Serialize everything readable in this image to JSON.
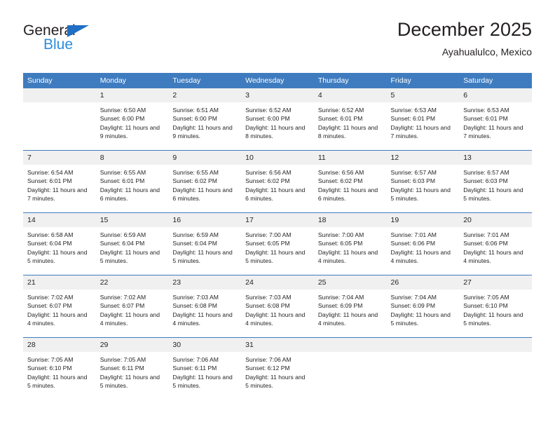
{
  "brand": {
    "name_top": "General",
    "name_bottom": "Blue",
    "triangle_color": "#1f6fc4",
    "blue_text_color": "#2b8ddf"
  },
  "header": {
    "title": "December 2025",
    "subtitle": "Ayahualulco, Mexico",
    "header_bg_color": "#3f7cbf",
    "daynum_bg_color": "#f0f0f0"
  },
  "calendar": {
    "weekday_headers": [
      "Sunday",
      "Monday",
      "Tuesday",
      "Wednesday",
      "Thursday",
      "Friday",
      "Saturday"
    ],
    "labels": {
      "sunrise": "Sunrise:",
      "sunset": "Sunset:",
      "daylight": "Daylight:"
    },
    "weeks": [
      [
        {
          "day": "",
          "empty": true
        },
        {
          "day": "1",
          "sunrise": "Sunrise: 6:50 AM",
          "sunset": "Sunset: 6:00 PM",
          "daylight": "Daylight: 11 hours and 9 minutes."
        },
        {
          "day": "2",
          "sunrise": "Sunrise: 6:51 AM",
          "sunset": "Sunset: 6:00 PM",
          "daylight": "Daylight: 11 hours and 9 minutes."
        },
        {
          "day": "3",
          "sunrise": "Sunrise: 6:52 AM",
          "sunset": "Sunset: 6:00 PM",
          "daylight": "Daylight: 11 hours and 8 minutes."
        },
        {
          "day": "4",
          "sunrise": "Sunrise: 6:52 AM",
          "sunset": "Sunset: 6:01 PM",
          "daylight": "Daylight: 11 hours and 8 minutes."
        },
        {
          "day": "5",
          "sunrise": "Sunrise: 6:53 AM",
          "sunset": "Sunset: 6:01 PM",
          "daylight": "Daylight: 11 hours and 7 minutes."
        },
        {
          "day": "6",
          "sunrise": "Sunrise: 6:53 AM",
          "sunset": "Sunset: 6:01 PM",
          "daylight": "Daylight: 11 hours and 7 minutes."
        }
      ],
      [
        {
          "day": "7",
          "sunrise": "Sunrise: 6:54 AM",
          "sunset": "Sunset: 6:01 PM",
          "daylight": "Daylight: 11 hours and 7 minutes."
        },
        {
          "day": "8",
          "sunrise": "Sunrise: 6:55 AM",
          "sunset": "Sunset: 6:01 PM",
          "daylight": "Daylight: 11 hours and 6 minutes."
        },
        {
          "day": "9",
          "sunrise": "Sunrise: 6:55 AM",
          "sunset": "Sunset: 6:02 PM",
          "daylight": "Daylight: 11 hours and 6 minutes."
        },
        {
          "day": "10",
          "sunrise": "Sunrise: 6:56 AM",
          "sunset": "Sunset: 6:02 PM",
          "daylight": "Daylight: 11 hours and 6 minutes."
        },
        {
          "day": "11",
          "sunrise": "Sunrise: 6:56 AM",
          "sunset": "Sunset: 6:02 PM",
          "daylight": "Daylight: 11 hours and 6 minutes."
        },
        {
          "day": "12",
          "sunrise": "Sunrise: 6:57 AM",
          "sunset": "Sunset: 6:03 PM",
          "daylight": "Daylight: 11 hours and 5 minutes."
        },
        {
          "day": "13",
          "sunrise": "Sunrise: 6:57 AM",
          "sunset": "Sunset: 6:03 PM",
          "daylight": "Daylight: 11 hours and 5 minutes."
        }
      ],
      [
        {
          "day": "14",
          "sunrise": "Sunrise: 6:58 AM",
          "sunset": "Sunset: 6:04 PM",
          "daylight": "Daylight: 11 hours and 5 minutes."
        },
        {
          "day": "15",
          "sunrise": "Sunrise: 6:59 AM",
          "sunset": "Sunset: 6:04 PM",
          "daylight": "Daylight: 11 hours and 5 minutes."
        },
        {
          "day": "16",
          "sunrise": "Sunrise: 6:59 AM",
          "sunset": "Sunset: 6:04 PM",
          "daylight": "Daylight: 11 hours and 5 minutes."
        },
        {
          "day": "17",
          "sunrise": "Sunrise: 7:00 AM",
          "sunset": "Sunset: 6:05 PM",
          "daylight": "Daylight: 11 hours and 5 minutes."
        },
        {
          "day": "18",
          "sunrise": "Sunrise: 7:00 AM",
          "sunset": "Sunset: 6:05 PM",
          "daylight": "Daylight: 11 hours and 4 minutes."
        },
        {
          "day": "19",
          "sunrise": "Sunrise: 7:01 AM",
          "sunset": "Sunset: 6:06 PM",
          "daylight": "Daylight: 11 hours and 4 minutes."
        },
        {
          "day": "20",
          "sunrise": "Sunrise: 7:01 AM",
          "sunset": "Sunset: 6:06 PM",
          "daylight": "Daylight: 11 hours and 4 minutes."
        }
      ],
      [
        {
          "day": "21",
          "sunrise": "Sunrise: 7:02 AM",
          "sunset": "Sunset: 6:07 PM",
          "daylight": "Daylight: 11 hours and 4 minutes."
        },
        {
          "day": "22",
          "sunrise": "Sunrise: 7:02 AM",
          "sunset": "Sunset: 6:07 PM",
          "daylight": "Daylight: 11 hours and 4 minutes."
        },
        {
          "day": "23",
          "sunrise": "Sunrise: 7:03 AM",
          "sunset": "Sunset: 6:08 PM",
          "daylight": "Daylight: 11 hours and 4 minutes."
        },
        {
          "day": "24",
          "sunrise": "Sunrise: 7:03 AM",
          "sunset": "Sunset: 6:08 PM",
          "daylight": "Daylight: 11 hours and 4 minutes."
        },
        {
          "day": "25",
          "sunrise": "Sunrise: 7:04 AM",
          "sunset": "Sunset: 6:09 PM",
          "daylight": "Daylight: 11 hours and 4 minutes."
        },
        {
          "day": "26",
          "sunrise": "Sunrise: 7:04 AM",
          "sunset": "Sunset: 6:09 PM",
          "daylight": "Daylight: 11 hours and 5 minutes."
        },
        {
          "day": "27",
          "sunrise": "Sunrise: 7:05 AM",
          "sunset": "Sunset: 6:10 PM",
          "daylight": "Daylight: 11 hours and 5 minutes."
        }
      ],
      [
        {
          "day": "28",
          "sunrise": "Sunrise: 7:05 AM",
          "sunset": "Sunset: 6:10 PM",
          "daylight": "Daylight: 11 hours and 5 minutes."
        },
        {
          "day": "29",
          "sunrise": "Sunrise: 7:05 AM",
          "sunset": "Sunset: 6:11 PM",
          "daylight": "Daylight: 11 hours and 5 minutes."
        },
        {
          "day": "30",
          "sunrise": "Sunrise: 7:06 AM",
          "sunset": "Sunset: 6:11 PM",
          "daylight": "Daylight: 11 hours and 5 minutes."
        },
        {
          "day": "31",
          "sunrise": "Sunrise: 7:06 AM",
          "sunset": "Sunset: 6:12 PM",
          "daylight": "Daylight: 11 hours and 5 minutes."
        },
        {
          "day": "",
          "empty": true
        },
        {
          "day": "",
          "empty": true
        },
        {
          "day": "",
          "empty": true
        }
      ]
    ]
  }
}
